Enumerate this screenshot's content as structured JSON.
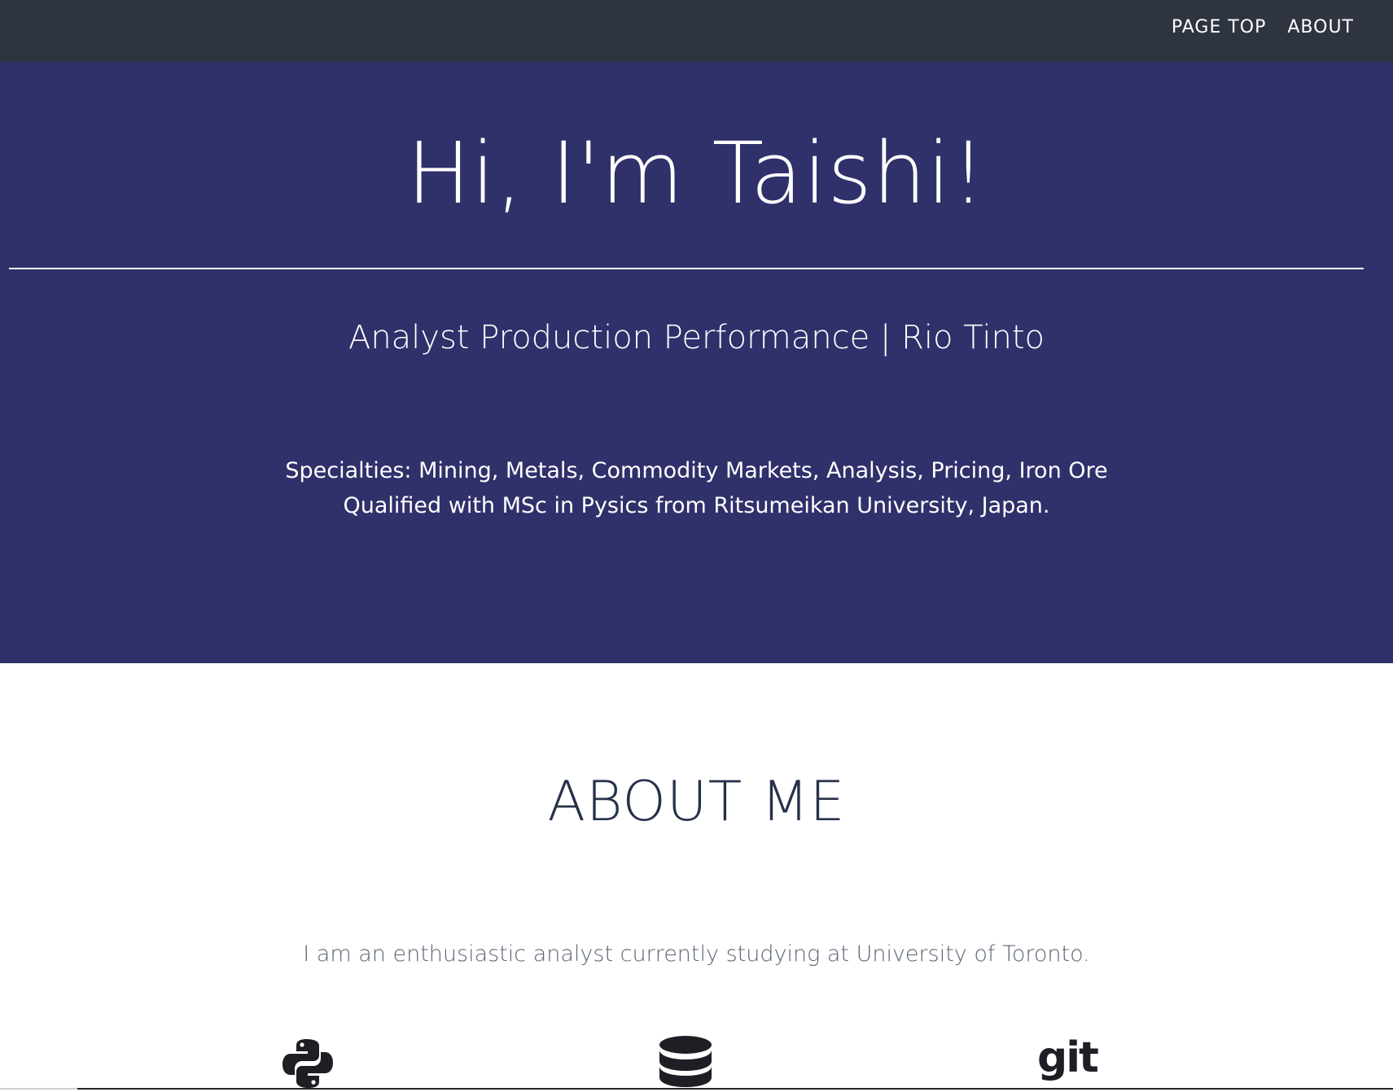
{
  "navbar": {
    "links": [
      {
        "label": "PAGE TOP"
      },
      {
        "label": "ABOUT"
      }
    ]
  },
  "hero": {
    "title": "Hi, I'm Taishi!",
    "subtitle": "Analyst Production Performance | Rio Tinto",
    "specialties": "Specialties: Mining, Metals, Commodity Markets, Analysis, Pricing, Iron Ore",
    "qualification": "Qualified with MSc in Pysics from Ritsumeikan University, Japan."
  },
  "about": {
    "heading": "ABOUT ME",
    "text": "I am an enthusiastic analyst currently studying at University of Toronto."
  },
  "skills": [
    {
      "icon": "python-icon"
    },
    {
      "icon": "database-icon"
    },
    {
      "icon": "git-icon",
      "label": "git"
    }
  ],
  "colors": {
    "navbar_bg": "#2e3440",
    "hero_bg": "#30306b",
    "heading_text": "#26324a",
    "body_text": "#5c6675"
  }
}
